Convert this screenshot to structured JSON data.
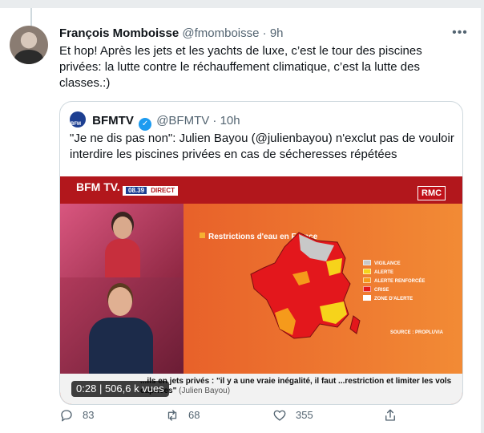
{
  "tweet": {
    "author_name": "François Momboisse",
    "author_handle": "@fmomboisse",
    "separator": "·",
    "time": "9h",
    "more_label": "•••",
    "text": "Et hop! Après les jets et les yachts de luxe, c’est le tour des piscines\nprivées: la lutte contre le réchauffement climatique, c’est la lutte des\nclasses.:)"
  },
  "quoted": {
    "author_name": "BFMTV",
    "author_handle": "@BFMTV",
    "separator": "·",
    "time": "10h",
    "verified_glyph": "✓",
    "text": "\"Je ne dis pas non\": Julien Bayou (@julienbayou) n'exclut pas de vouloir interdire les piscines privées en cas de sécheresses répétées",
    "media": {
      "channel_logo": "BFM TV.",
      "live_time": "08.39",
      "live_label": "DIRECT",
      "partner_logo": "RMC",
      "map_title": "Restrictions d'eau en France",
      "legend": [
        {
          "label": "VIGILANCE",
          "color": "#c8c8c8"
        },
        {
          "label": "ALERTE",
          "color": "#f6d31b"
        },
        {
          "label": "ALERTE RENFORCÉE",
          "color": "#f59a1b"
        },
        {
          "label": "CRISE",
          "color": "#e3171c"
        },
        {
          "label": "ZONE D'ALERTE",
          "color": "#ffffff"
        }
      ],
      "source": "SOURCE : PROPLUVIA",
      "ticker": "...ils en jets privés : \"il y a une vraie inégalité, il faut ...restriction et limiter les vols caprices\"",
      "ticker_speaker": "(Julien Bayou)",
      "video_time": "0:28",
      "video_views": "506,6 k vues"
    }
  },
  "actions": {
    "reply_count": "83",
    "retweet_count": "68",
    "like_count": "355"
  }
}
